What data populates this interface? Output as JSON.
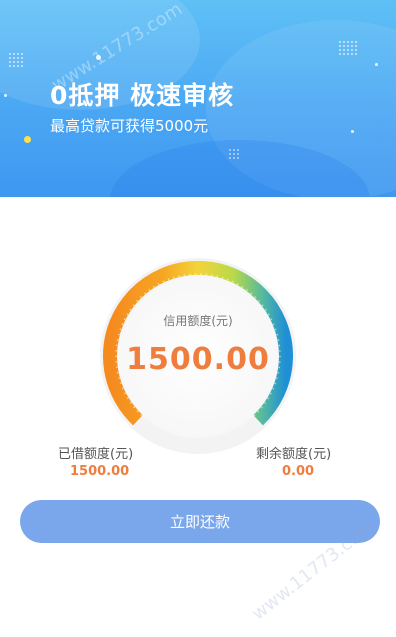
{
  "banner": {
    "title": "0抵押  极速审核",
    "subtitle": "最高贷款可获得5000元",
    "accent": "#4aa7f3"
  },
  "gauge": {
    "label": "信用额度(元)",
    "amount": "1500.00",
    "colors": [
      "#f58a1f",
      "#f6c23a",
      "#d8e13a",
      "#7cc576",
      "#1f8fd6"
    ]
  },
  "stats": {
    "borrowed_label": "已借额度(元)",
    "borrowed_value": "1500.00",
    "remaining_label": "剩余额度(元)",
    "remaining_value": "0.00"
  },
  "actions": {
    "repay_label": "立即还款"
  },
  "watermark": {
    "text": "www.11773.com"
  }
}
